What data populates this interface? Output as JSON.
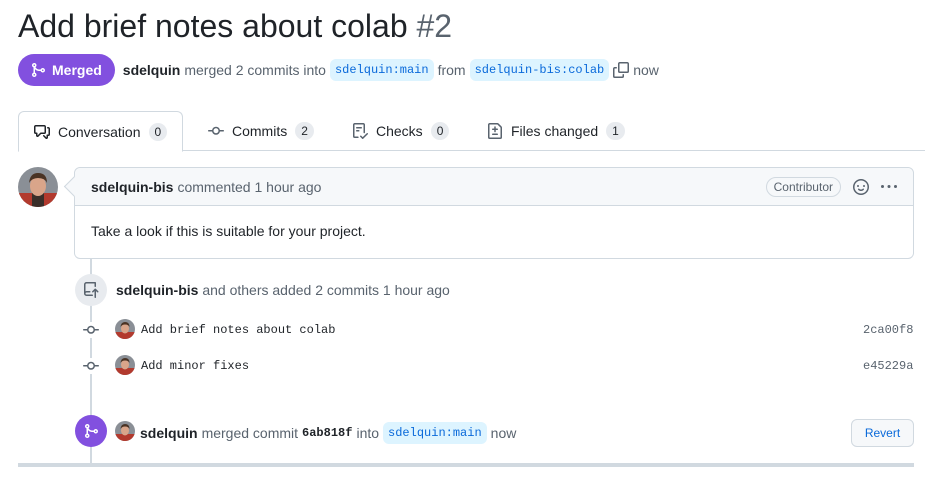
{
  "pr": {
    "title": "Add brief notes about colab",
    "number": "#2"
  },
  "status": {
    "badge": "Merged",
    "author": "sdelquin",
    "action": "merged 2 commits into",
    "base_branch": "sdelquin:main",
    "from_word": "from",
    "head_branch": "sdelquin-bis:colab",
    "time": "now"
  },
  "tabs": [
    {
      "label": "Conversation",
      "count": "0",
      "icon": "comment-discussion-icon"
    },
    {
      "label": "Commits",
      "count": "2",
      "icon": "git-commit-icon"
    },
    {
      "label": "Checks",
      "count": "0",
      "icon": "checklist-icon"
    },
    {
      "label": "Files changed",
      "count": "1",
      "icon": "file-diff-icon"
    }
  ],
  "comment": {
    "author": "sdelquin-bis",
    "meta": "commented 1 hour ago",
    "role": "Contributor",
    "body": "Take a look if this is suitable for your project."
  },
  "commits_event": {
    "author": "sdelquin-bis",
    "text": "and others added 2 commits 1 hour ago"
  },
  "commits": [
    {
      "message": "Add brief notes about colab",
      "sha": "2ca00f8"
    },
    {
      "message": "Add minor fixes",
      "sha": "e45229a"
    }
  ],
  "merge_event": {
    "author": "sdelquin",
    "text_before": "merged commit",
    "sha": "6ab818f",
    "text_into": "into",
    "branch": "sdelquin:main",
    "time": "now",
    "revert_label": "Revert"
  },
  "colors": {
    "merged_purple": "#8250df",
    "link_blue": "#0969da",
    "branch_bg": "#ddf4ff",
    "border": "#d1d9e0"
  }
}
